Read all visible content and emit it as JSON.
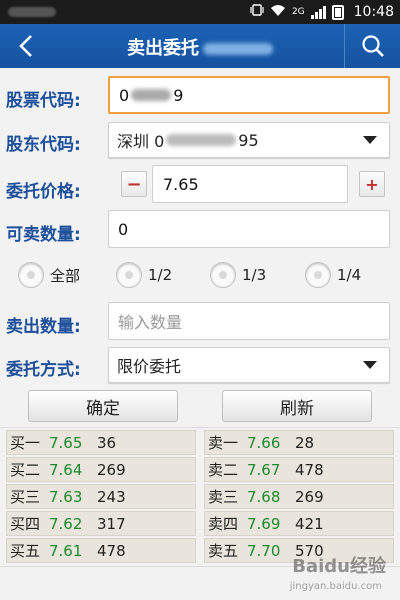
{
  "status_bar": {
    "network": "2G",
    "time": "10:48"
  },
  "header": {
    "title": "卖出委托"
  },
  "form": {
    "stock_code": {
      "label": "股票代码:",
      "value_start": "0",
      "value_end": "9"
    },
    "holder_code": {
      "label": "股东代码:",
      "value_start": "深圳 0",
      "value_end": "95"
    },
    "price": {
      "label": "委托价格:",
      "value": "7.65",
      "minus": "−",
      "plus": "+"
    },
    "sellable_qty": {
      "label": "可卖数量:",
      "value": "0"
    },
    "ratio_options": [
      "全部",
      "1/2",
      "1/3",
      "1/4"
    ],
    "sell_qty": {
      "label": "卖出数量:",
      "placeholder": "输入数量"
    },
    "order_type": {
      "label": "委托方式:",
      "value": "限价委托"
    }
  },
  "buttons": {
    "confirm": "确定",
    "refresh": "刷新"
  },
  "order_book": {
    "bids": [
      {
        "label": "买一",
        "price": "7.65",
        "volume": "36"
      },
      {
        "label": "买二",
        "price": "7.64",
        "volume": "269"
      },
      {
        "label": "买三",
        "price": "7.63",
        "volume": "243"
      },
      {
        "label": "买四",
        "price": "7.62",
        "volume": "317"
      },
      {
        "label": "买五",
        "price": "7.61",
        "volume": "478"
      }
    ],
    "asks": [
      {
        "label": "卖一",
        "price": "7.66",
        "volume": "28"
      },
      {
        "label": "卖二",
        "price": "7.67",
        "volume": "478"
      },
      {
        "label": "卖三",
        "price": "7.68",
        "volume": "269"
      },
      {
        "label": "卖四",
        "price": "7.69",
        "volume": "421"
      },
      {
        "label": "卖五",
        "price": "7.70",
        "volume": "570"
      }
    ]
  },
  "watermark": {
    "text": "Baidu经验",
    "sub": "jingyan.baidu.com"
  },
  "colors": {
    "header": "#1552a0",
    "label": "#1d4f9b",
    "price_green": "#1a8a2a",
    "focus": "#f0a040"
  }
}
